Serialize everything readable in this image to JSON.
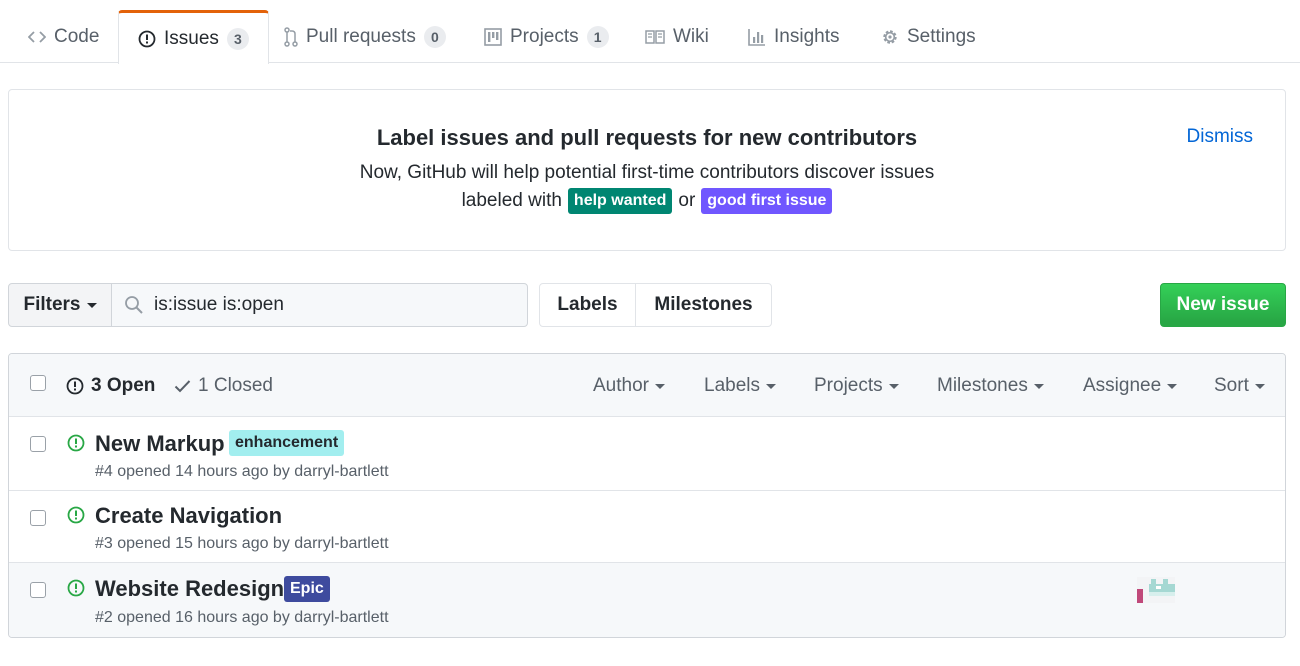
{
  "tabs": [
    {
      "label": "Code",
      "count": null,
      "icon": "code-icon"
    },
    {
      "label": "Issues",
      "count": "3",
      "icon": "issue-opened-icon"
    },
    {
      "label": "Pull requests",
      "count": "0",
      "icon": "git-pull-request-icon"
    },
    {
      "label": "Projects",
      "count": "1",
      "icon": "project-icon"
    },
    {
      "label": "Wiki",
      "count": null,
      "icon": "book-icon"
    },
    {
      "label": "Insights",
      "count": null,
      "icon": "graph-icon"
    },
    {
      "label": "Settings",
      "count": null,
      "icon": "gear-icon"
    }
  ],
  "banner": {
    "title": "Label issues and pull requests for new contributors",
    "text": "Now, GitHub will help potential first-time contributors discover issues",
    "line2_prefix": "labeled with",
    "label1": "help wanted",
    "label1_color": "#008672",
    "connector": "or",
    "label2": "good first issue",
    "label2_color": "#7057ff",
    "dismiss": "Dismiss"
  },
  "subnav": {
    "filters": "Filters",
    "search_value": "is:issue is:open",
    "labels": "Labels",
    "milestones": "Milestones",
    "new_issue": "New issue"
  },
  "list_header": {
    "open": "3 Open",
    "closed": "1 Closed",
    "menus": [
      "Author",
      "Labels",
      "Projects",
      "Milestones",
      "Assignee",
      "Sort"
    ]
  },
  "issues": [
    {
      "title": "New Markup",
      "label": "enhancement",
      "label_bg": "#a2eeef",
      "label_fg": "#24292e",
      "meta": "#4 opened 14 hours ago by darryl-bartlett"
    },
    {
      "title": "Create Navigation",
      "label": "",
      "meta": "#3 opened 15 hours ago by darryl-bartlett"
    },
    {
      "title": "Website Redesign",
      "label": "Epic",
      "label_bg": "#3e4b9e",
      "label_fg": "#ffffff",
      "meta": "#2 opened 16 hours ago by darryl-bartlett"
    }
  ],
  "colors": {
    "accent_tab": "#e36209",
    "open_green": "#28a745",
    "link": "#0366d6"
  }
}
